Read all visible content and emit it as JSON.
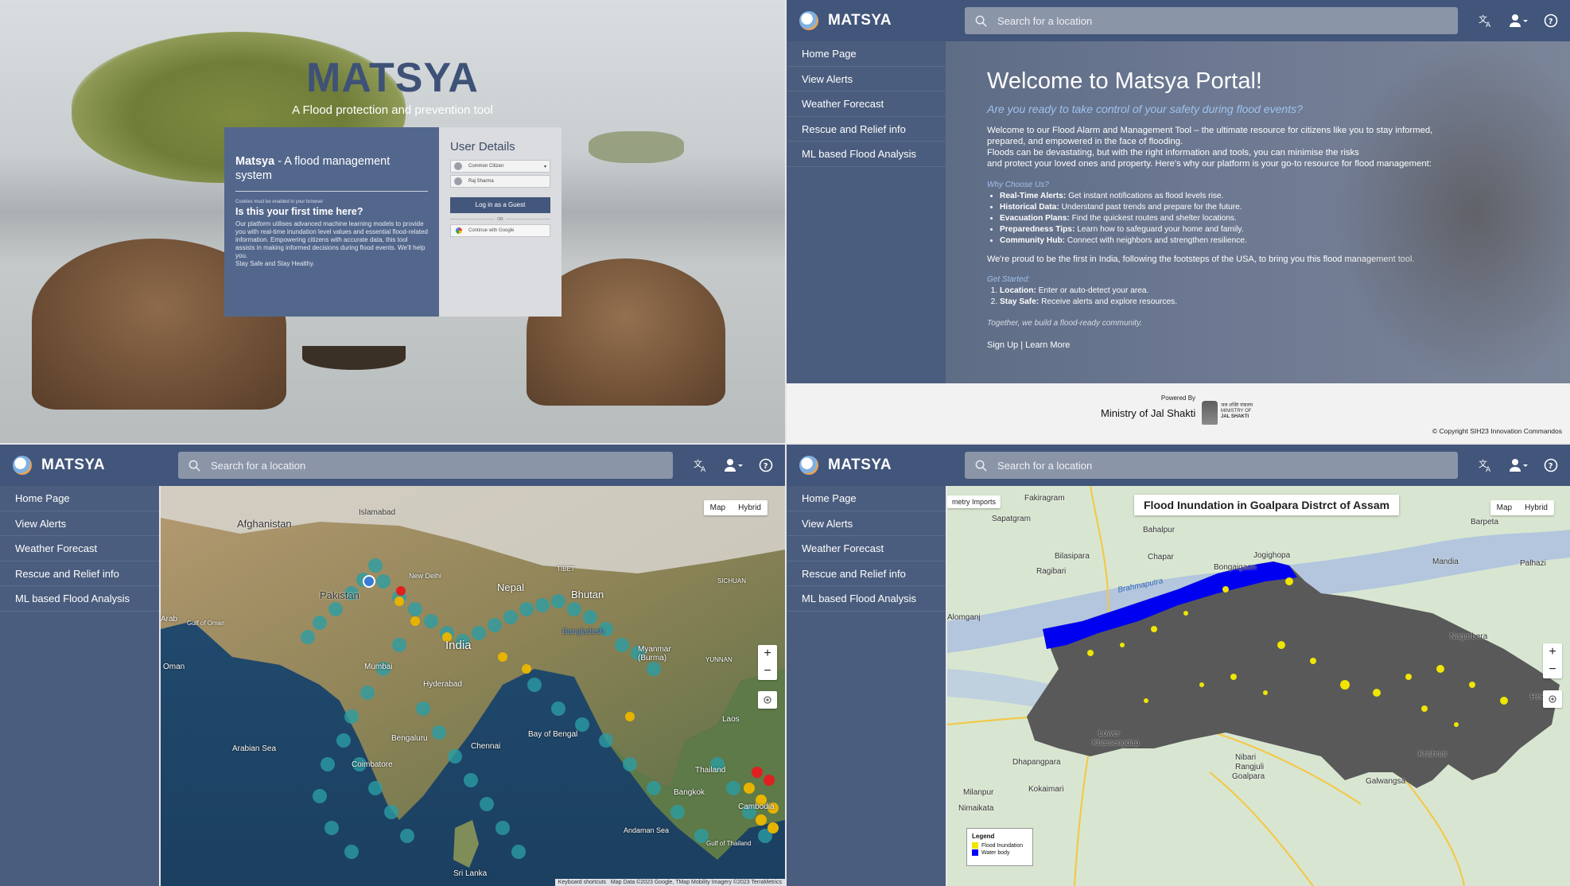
{
  "brand": {
    "name": "MATSYA"
  },
  "search": {
    "placeholder": "Search for a location"
  },
  "sidebar": {
    "items": [
      {
        "label": "Home Page"
      },
      {
        "label": "View Alerts"
      },
      {
        "label": "Weather Forecast"
      },
      {
        "label": "Rescue and Relief info"
      },
      {
        "label": "ML based Flood Analysis"
      }
    ]
  },
  "topbar_icons": [
    "translate-icon",
    "account-icon",
    "help-icon"
  ],
  "login": {
    "title": "MATSYA",
    "subtitle": "A Flood protection and prevention tool",
    "card": {
      "heading_bold": "Matsya",
      "heading_rest": " - A flood management system",
      "cookie_note": "Cookies must be enabled in your browser",
      "first_time": "Is this your first time here?",
      "body": "Our platform utilises advanced machine learning models to provide you with real-time inundation level values and essential flood-related information. Empowering citizens with accurate data, this tool assists in making informed decisions during flood events. We'll help you.",
      "stay_safe": "Stay Safe and Stay Healthy."
    },
    "user_details": {
      "title": "User Details",
      "role_value": "Common Citizen",
      "name_value": "Raj Sharma",
      "guest_button": "Log in as a Guest",
      "or": "OR",
      "google_button": "Continue with Google"
    }
  },
  "portal": {
    "welcome": "Welcome to Matsya Portal!",
    "question": "Are you ready to take control of your safety during flood events?",
    "intro": "Welcome to our Flood Alarm and Management Tool – the ultimate resource for citizens like you to stay informed, prepared, and empowered in the face of flooding.",
    "intro2": "Floods can be devastating, but with the right information and tools, you can minimise the risks",
    "intro3": "and protect your loved ones and property. Here's why our platform is your go-to resource for flood management:",
    "why": "Why Choose Us?",
    "features": [
      {
        "title": "Real-Time Alerts:",
        "text": " Get instant notifications as flood levels rise."
      },
      {
        "title": "Historical Data:",
        "text": " Understand past trends and prepare for the future."
      },
      {
        "title": "Evacuation Plans:",
        "text": " Find the quickest routes and shelter locations."
      },
      {
        "title": "Preparedness Tips:",
        "text": " Learn how to safeguard your home and family."
      },
      {
        "title": "Community Hub:",
        "text": " Connect with neighbors and strengthen resilience."
      }
    ],
    "proud": "We're proud to be the first in India, following the footsteps of the USA, to bring you this flood management tool.",
    "get_started": "Get Started:",
    "steps": [
      {
        "title": "Location:",
        "text": " Enter or auto-detect your area."
      },
      {
        "title": "Stay Safe:",
        "text": " Receive alerts and explore resources."
      }
    ],
    "together": "Together, we build a flood-ready community.",
    "signup": "Sign Up",
    "learn_more": "Learn More",
    "powered_by": "Powered By",
    "ministry": "Ministry of Jal Shakti",
    "emblem_line1": "जल शक्ति मंत्रालय",
    "emblem_line2": "MINISTRY OF",
    "emblem_line3": "JAL SHAKTI",
    "copyright": "© Copyright  SIH23 Innovation Commandos"
  },
  "map": {
    "toggle_map": "Map",
    "toggle_hybrid": "Hybrid",
    "zoom_in": "+",
    "zoom_out": "−",
    "labels": {
      "afghanistan": "Afghanistan",
      "islamabad": "Islamabad",
      "pakistan": "Pakistan",
      "nepal": "Nepal",
      "bhutan": "Bhutan",
      "bangladesh": "Bangladesh",
      "india": "India",
      "myanmar": "Myanmar\n(Burma)",
      "mumbai": "Mumbai",
      "hyderabad": "Hyderabad",
      "chennai": "Chennai",
      "bengaluru": "Bengaluru",
      "arabian_sea": "Arabian Sea",
      "bay_of_bengal": "Bay of Bengal",
      "sri_lanka": "Sri Lanka",
      "oman": "Oman",
      "laos": "Laos",
      "thailand": "Thailand",
      "cambodia": "Cambodia",
      "bangkok": "Bangkok",
      "andaman_sea": "Andaman Sea",
      "gulf_thailand": "Gulf of Thailand",
      "sichuan": "SICHUAN",
      "yunnan": "YUNNAN",
      "tibet": "TIBET",
      "new_delhi": "New Delhi",
      "coimbatore": "Coimbatore",
      "gulf_oman": "Gulf of Oman",
      "arab": "Arab"
    },
    "attribution_1": "Keyboard shortcuts",
    "attribution_2": "Map Data ©2023 Google, TMap Mobility Imagery ©2023 TerraMetrics"
  },
  "inundation": {
    "title": "Flood Inundation in Goalpara Distrct of Assam",
    "overlay_tab": "metry Imports",
    "legend_title": "Legend",
    "legend_items": [
      {
        "label": "Flood Inundation",
        "color": "#f2e600"
      },
      {
        "label": "Water body",
        "color": "#0000ff"
      }
    ],
    "places": {
      "fakiragram": "Fakiragram",
      "sapatgram": "Sapatgram",
      "bahalpur": "Bahalpur",
      "chapar": "Chapar",
      "bilasipara": "Bilasipara",
      "jogighopa": "Jogighopa",
      "bongaigaon": "Bongaigaon",
      "barpeta": "Barpeta",
      "mandia": "Mandia",
      "palhazi": "Palhazi",
      "nagarbera": "Nagarbera",
      "alomganj": "Alomganj",
      "dhapangpara": "Dhapangpara",
      "kharsengdap": "Kharsengdap",
      "goalpara": "Goalpara",
      "galwangsa": "Galwangsa",
      "milanpur": "Milanpur",
      "kokaimari": "Kokaimari",
      "nimaikata": "Nimaikata",
      "brahmaputra": "Brahmaputra",
      "lower": "Lower",
      "krishnai": "Krishnai",
      "hekra": "Hekra",
      "nibari": "Nibari",
      "rangjuli": "Rangjuli",
      "ragibari": "Ragibari"
    }
  }
}
